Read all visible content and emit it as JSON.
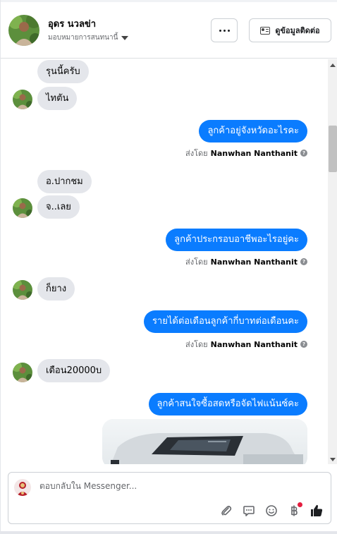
{
  "header": {
    "contact_name": "อุดร นวลข่า",
    "assign_label": "มอบหมายการสนทนานี้",
    "more_label": "...",
    "contact_info_label": "ดูข้อมูลติดต่อ"
  },
  "messages": {
    "m1": "รุนนี้ครับ",
    "m2": "ไทตัน",
    "m3": "ลูกค้าอยู่จังหวัดอะไรคะ",
    "m4": "อ.ปากชม",
    "m5": "จ..เลย",
    "m6": "ลูกค้าประกรอบอาชีพอะไรอยู่คะ",
    "m7": "ก็ยาง",
    "m8": "รายได้ต่อเดือนลูกค้ากี่บาทต่อเดือนคะ",
    "m9": "เดือน20000บ",
    "m10": "ลูกค้าสนใจซื้อสดหรือจัดไฟแน้นซ์คะ"
  },
  "sent_by": {
    "prefix": "ส่งโดย",
    "name": "Nanwhan Nanthanit",
    "info": "?"
  },
  "composer": {
    "placeholder": "ตอบกลับใน Messenger..."
  },
  "icons": {
    "attach": "paperclip-icon",
    "saved_replies": "chat-bubble-icon",
    "emoji": "smiley-icon",
    "payment": "baht-icon",
    "like": "thumbs-up-icon"
  },
  "colors": {
    "outgoing_bubble": "#0a7cff",
    "incoming_bubble": "#e4e6eb",
    "notification_dot": "#e41e3f"
  }
}
